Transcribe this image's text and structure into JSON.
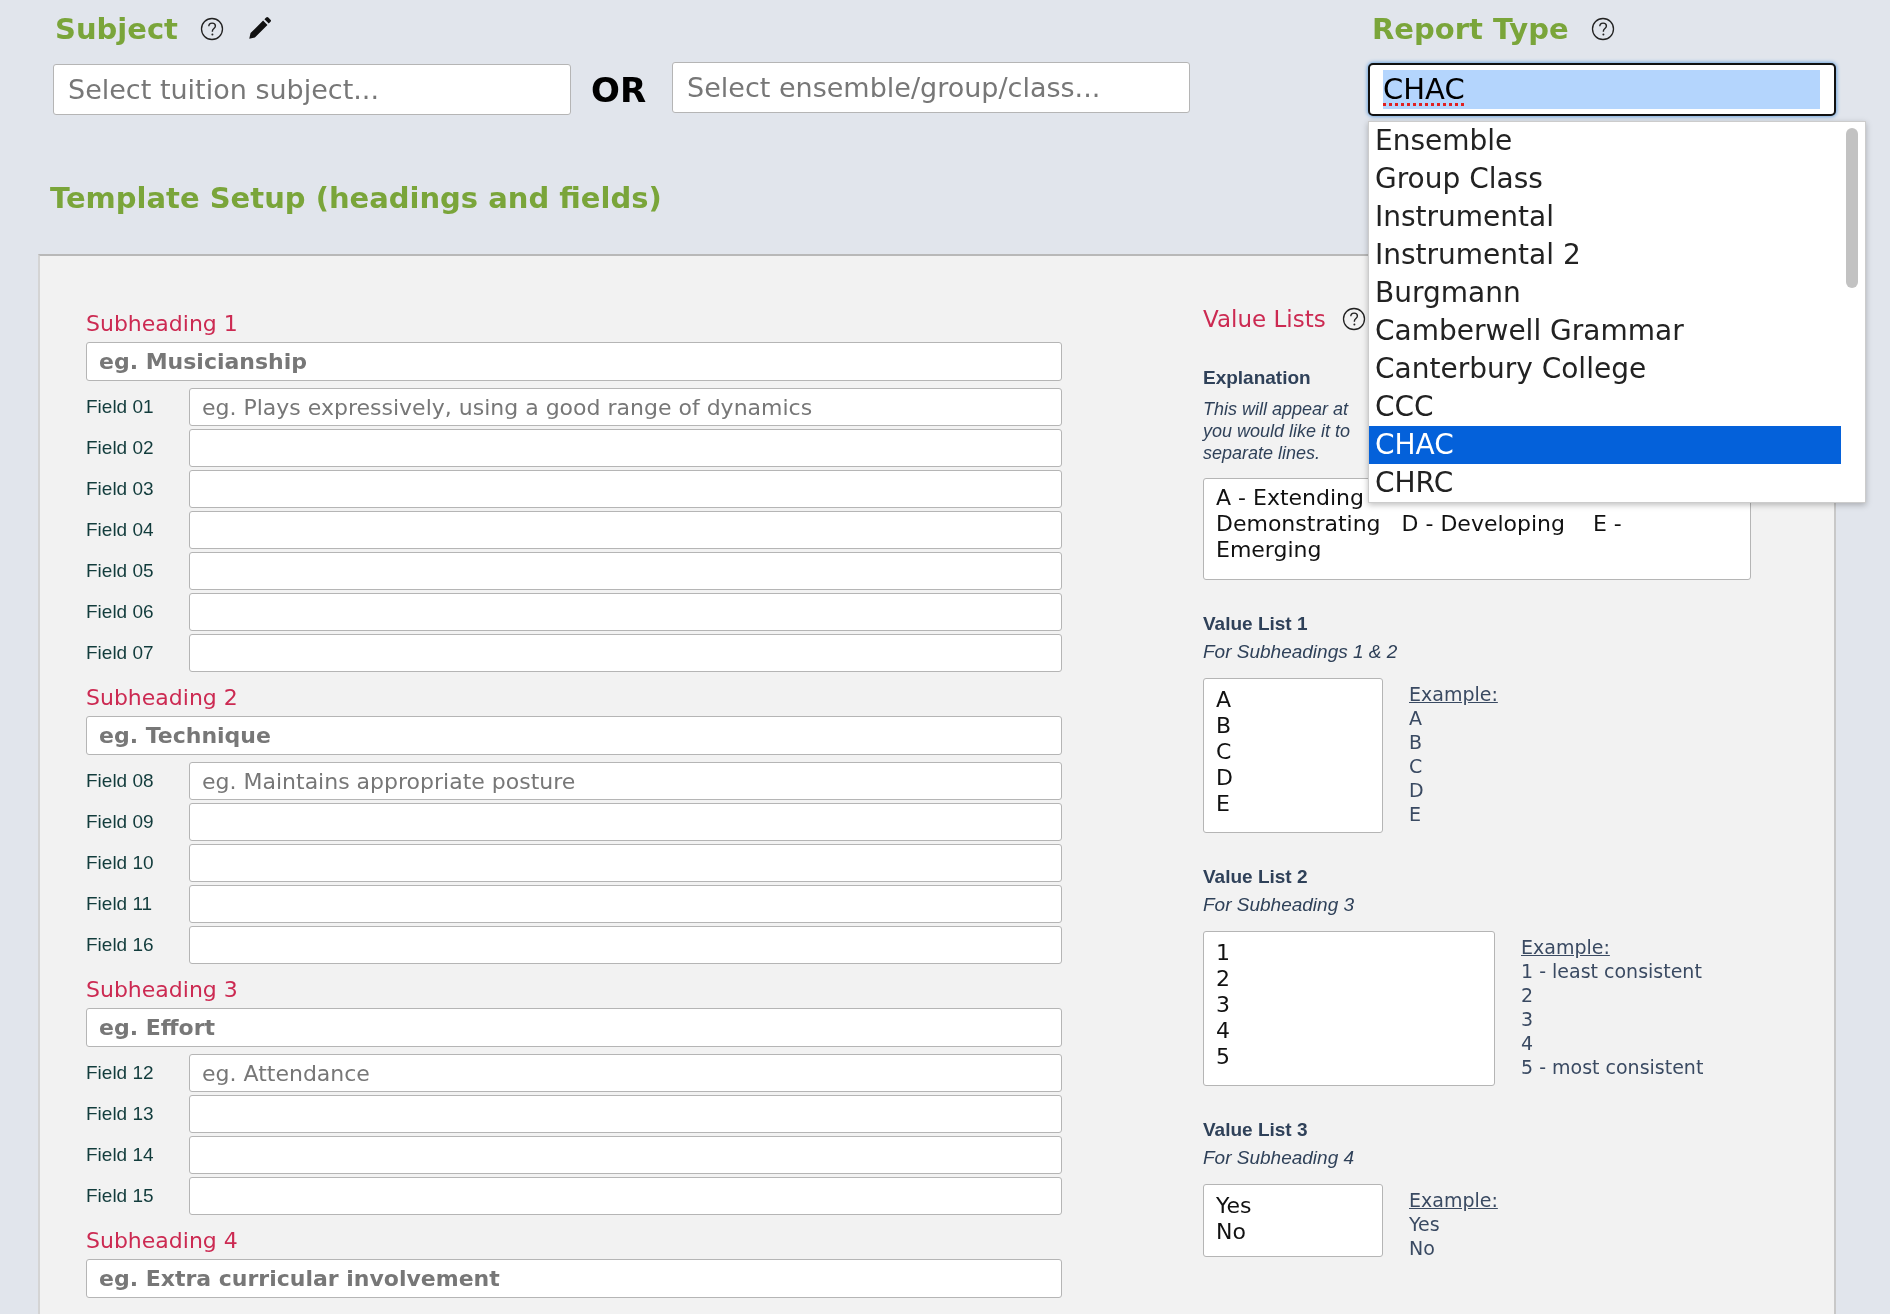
{
  "subject": {
    "title": "Subject",
    "tuition_field": {
      "placeholder": "Select tuition subject..."
    },
    "or_label": "OR",
    "ensemble_field": {
      "placeholder": "Select ensemble/group/class..."
    }
  },
  "report_type": {
    "title": "Report Type",
    "value": "CHAC",
    "dropdown": [
      {
        "label": "Ensemble",
        "selected": false
      },
      {
        "label": "Group Class",
        "selected": false
      },
      {
        "label": "Instrumental",
        "selected": false
      },
      {
        "label": "Instrumental 2",
        "selected": false
      },
      {
        "label": "Burgmann",
        "selected": false
      },
      {
        "label": "Camberwell Grammar",
        "selected": false
      },
      {
        "label": "Canterbury College",
        "selected": false
      },
      {
        "label": "CCC",
        "selected": false
      },
      {
        "label": "CHAC",
        "selected": true
      },
      {
        "label": "CHRC",
        "selected": false
      }
    ]
  },
  "template_setup": {
    "title": "Template Setup (headings and fields)"
  },
  "subheadings": [
    {
      "label": "Subheading 1",
      "placeholder": "eg. Musicianship",
      "fields": [
        {
          "label": "Field 01",
          "placeholder": "eg. Plays expressively, using a good range of dynamics"
        },
        {
          "label": "Field 02"
        },
        {
          "label": "Field 03"
        },
        {
          "label": "Field 04"
        },
        {
          "label": "Field 05"
        },
        {
          "label": "Field 06"
        },
        {
          "label": "Field 07"
        }
      ]
    },
    {
      "label": "Subheading 2",
      "placeholder": "eg. Technique",
      "fields": [
        {
          "label": "Field 08",
          "placeholder": "eg. Maintains appropriate posture"
        },
        {
          "label": "Field 09"
        },
        {
          "label": "Field 10"
        },
        {
          "label": "Field 11"
        },
        {
          "label": "Field 16"
        }
      ]
    },
    {
      "label": "Subheading 3",
      "placeholder": "eg. Effort",
      "fields": [
        {
          "label": "Field 12",
          "placeholder": "eg. Attendance"
        },
        {
          "label": "Field 13"
        },
        {
          "label": "Field 14"
        },
        {
          "label": "Field 15"
        }
      ]
    },
    {
      "label": "Subheading 4",
      "placeholder": "eg. Extra curricular involvement"
    }
  ],
  "value_lists": {
    "title": "Value Lists",
    "explanation": {
      "title": "Explanation",
      "description_lines": [
        "This will appear at",
        "you would like it to",
        "separate lines."
      ],
      "value_lines": [
        "A - Extending",
        "Demonstrating   D - Developing    E -",
        "Emerging"
      ]
    },
    "lists": [
      {
        "title": "Value List 1",
        "subtitle": "For Subheadings 1 & 2",
        "values": [
          "A",
          "B",
          "C",
          "D",
          "E"
        ],
        "example_label": "Example:",
        "example": [
          "A",
          "B",
          "C",
          "D",
          "E"
        ]
      },
      {
        "title": "Value List 2",
        "subtitle": "For Subheading 3",
        "values": [
          "1",
          "2",
          "3",
          "4",
          "5"
        ],
        "example_label": "Example:",
        "example": [
          "1 - least consistent",
          "2",
          "3",
          "4",
          "5 - most consistent"
        ]
      },
      {
        "title": "Value List 3",
        "subtitle": "For Subheading 4",
        "values": [
          "Yes",
          "No"
        ],
        "example_label": "Example:",
        "example": [
          "Yes",
          "No"
        ]
      }
    ]
  }
}
